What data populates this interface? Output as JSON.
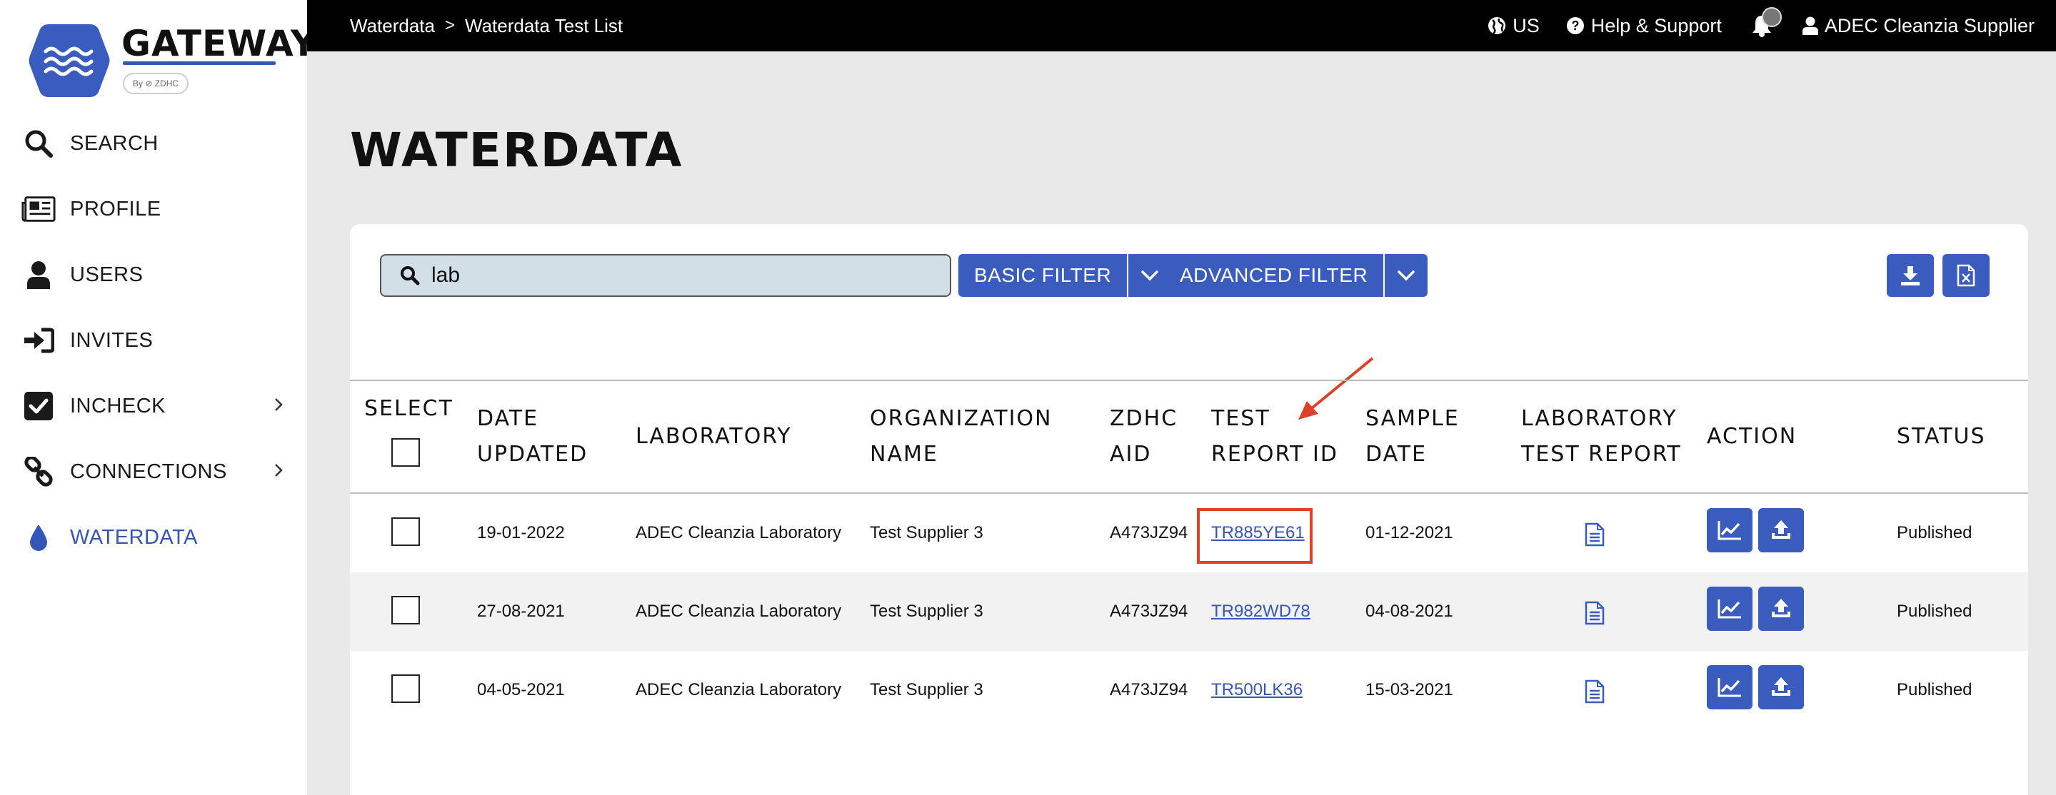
{
  "brand": {
    "name": "GATEWAY",
    "tagline": "By ⊘ ZDHC"
  },
  "nav": [
    {
      "label": "SEARCH",
      "icon": "search-icon"
    },
    {
      "label": "PROFILE",
      "icon": "newspaper-icon"
    },
    {
      "label": "USERS",
      "icon": "user-icon"
    },
    {
      "label": "INVITES",
      "icon": "sign-in-icon"
    },
    {
      "label": "INCHECK",
      "icon": "checkbox-icon",
      "has_submenu": true
    },
    {
      "label": "CONNECTIONS",
      "icon": "link-icon",
      "has_submenu": true
    },
    {
      "label": "WATERDATA",
      "icon": "water-drop-icon",
      "active": true
    }
  ],
  "breadcrumb": {
    "root": "Waterdata",
    "separator": ">",
    "current": "Waterdata Test List"
  },
  "topbar": {
    "region": "US",
    "help": "Help & Support",
    "notifications": "",
    "user": "ADEC Cleanzia Supplier"
  },
  "page": {
    "title": "WATERDATA"
  },
  "search": {
    "value": "lab",
    "placeholder": ""
  },
  "filters": {
    "basic": "BASIC FILTER",
    "advanced": "ADVANCED FILTER"
  },
  "table": {
    "headers": {
      "select": "SELECT",
      "date_updated_1": "DATE",
      "date_updated_2": "UPDATED",
      "laboratory": "LABORATORY",
      "organization_1": "ORGANIZATION",
      "organization_2": "NAME",
      "zdhc_1": "ZDHC",
      "zdhc_2": "AID",
      "test_report_1": "TEST",
      "test_report_2": "REPORT ID",
      "sample_1": "SAMPLE",
      "sample_2": "DATE",
      "lab_report_1": "LABORATORY",
      "lab_report_2": "TEST REPORT",
      "action": "ACTION",
      "status": "STATUS"
    },
    "rows": [
      {
        "date_updated": "19-01-2022",
        "laboratory": "ADEC Cleanzia Laboratory",
        "organization": "Test Supplier 3",
        "zdhc_aid": "A473JZ94",
        "test_report_id": "TR885YE61",
        "sample_date": "01-12-2021",
        "status": "Published"
      },
      {
        "date_updated": "27-08-2021",
        "laboratory": "ADEC Cleanzia Laboratory",
        "organization": "Test Supplier 3",
        "zdhc_aid": "A473JZ94",
        "test_report_id": "TR982WD78",
        "sample_date": "04-08-2021",
        "status": "Published"
      },
      {
        "date_updated": "04-05-2021",
        "laboratory": "ADEC Cleanzia Laboratory",
        "organization": "Test Supplier 3",
        "zdhc_aid": "A473JZ94",
        "test_report_id": "TR500LK36",
        "sample_date": "15-03-2021",
        "status": "Published"
      }
    ]
  },
  "colors": {
    "accent": "#3a5cbf",
    "highlight": "#e0402a",
    "topbar": "#000000"
  }
}
